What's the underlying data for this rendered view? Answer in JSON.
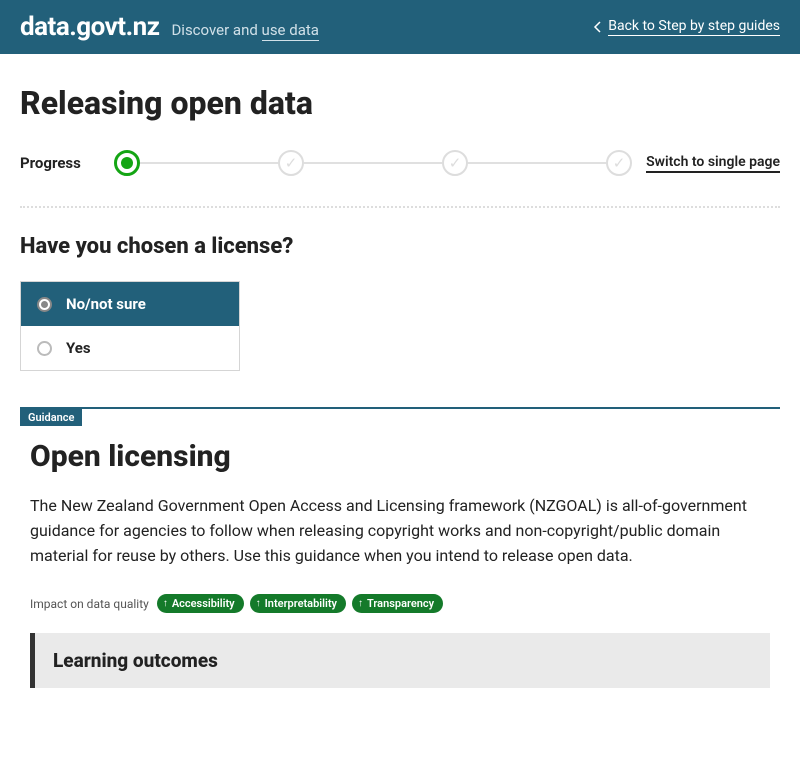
{
  "header": {
    "site_title": "data.govt.nz",
    "tagline_prefix": "Discover and ",
    "tagline_link": "use data",
    "back_label": "Back to Step by step guides"
  },
  "page": {
    "title": "Releasing open data",
    "progress_label": "Progress",
    "switch_link": "Switch to single page"
  },
  "question": {
    "text": "Have you chosen a license?",
    "option_no": "No/not sure",
    "option_yes": "Yes"
  },
  "guidance": {
    "tag": "Guidance",
    "title": "Open licensing",
    "body": "The New Zealand Government Open Access and Licensing framework (NZGOAL) is all-of-government guidance for agencies to follow when releasing copyright works and non-copyright/public domain material for reuse by others. Use this guidance when you intend to release open data.",
    "impact_label": "Impact on data quality",
    "pills": [
      "Accessibility",
      "Interpretability",
      "Transparency"
    ],
    "outcomes_title": "Learning outcomes"
  }
}
